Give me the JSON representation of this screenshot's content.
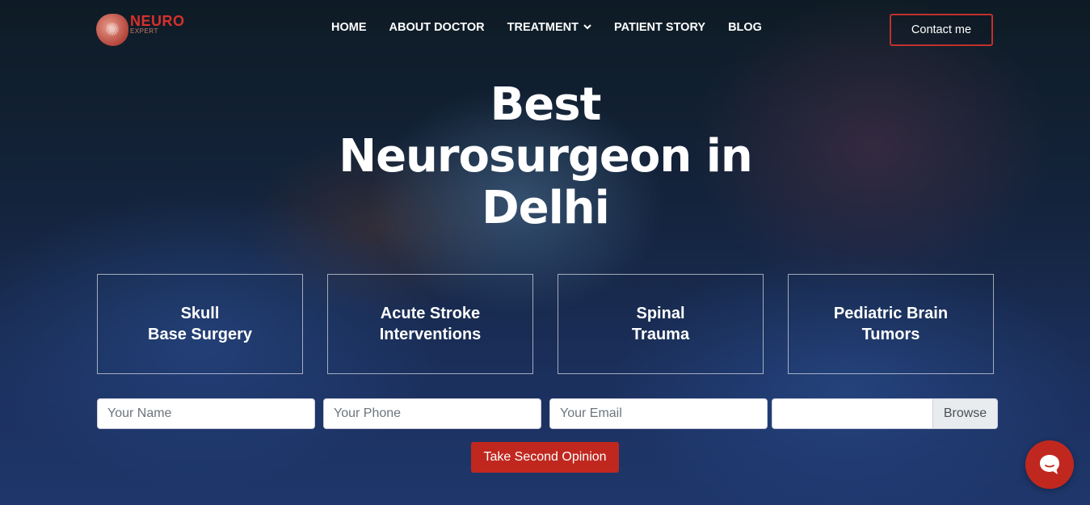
{
  "brand": {
    "name": "NEURO",
    "sub": "EXPERT"
  },
  "nav": {
    "items": [
      {
        "label": "HOME"
      },
      {
        "label": "ABOUT DOCTOR"
      },
      {
        "label": "TREATMENT",
        "has_dropdown": true
      },
      {
        "label": "PATIENT STORY"
      },
      {
        "label": "BLOG"
      }
    ],
    "contact_label": "Contact me"
  },
  "hero": {
    "title": "Best Neurosurgeon in Delhi"
  },
  "services": [
    {
      "label": "Skull\nBase Surgery"
    },
    {
      "label": "Acute Stroke\nInterventions"
    },
    {
      "label": "Spinal\nTrauma"
    },
    {
      "label": "Pediatric Brain\nTumors"
    }
  ],
  "form": {
    "name_placeholder": "Your Name",
    "phone_placeholder": "Your Phone",
    "email_placeholder": "Your Email",
    "browse_label": "Browse",
    "submit_label": "Take Second Opinion"
  },
  "colors": {
    "accent": "#c0281f",
    "brand_red": "#d8302b"
  },
  "icons": {
    "chat": "chat-bubble-icon",
    "dropdown": "chevron-down-icon",
    "logo": "brain-icon"
  }
}
